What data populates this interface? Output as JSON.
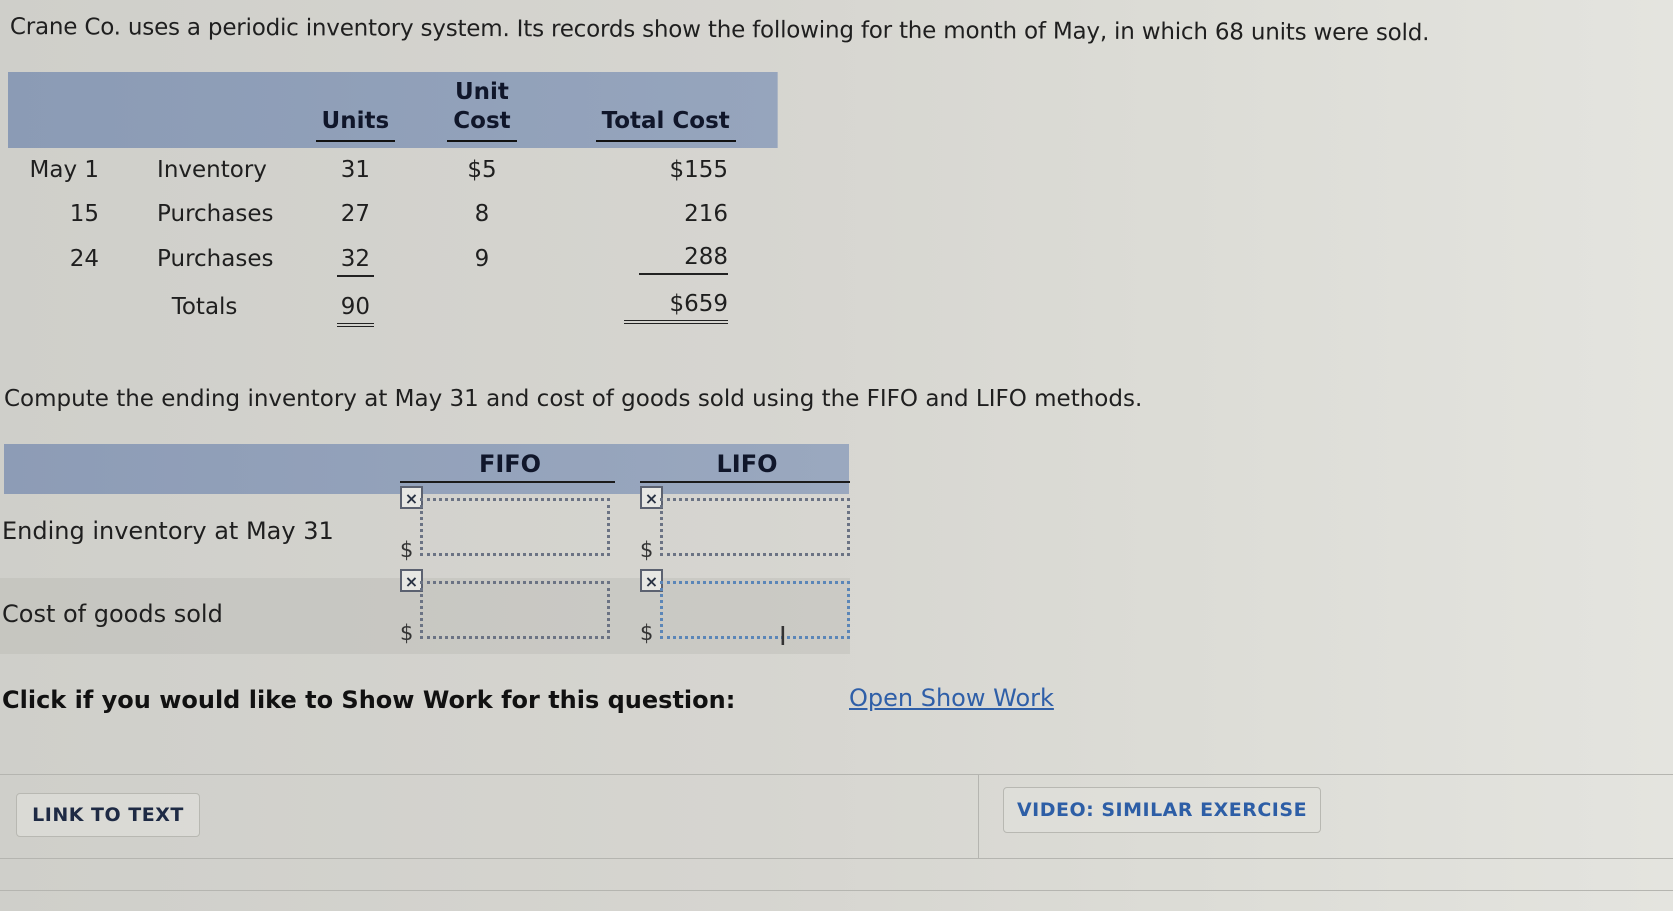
{
  "problem": {
    "intro": "Crane Co. uses a periodic inventory system. Its records show the following for the month of May, in which 68 units were sold.",
    "instruction": "Compute the ending inventory at May 31 and cost of goods sold using the FIFO and LIFO methods."
  },
  "records_table": {
    "headers": {
      "units": "Units",
      "unit_cost_line1": "Unit",
      "unit_cost_line2": "Cost",
      "total_cost": "Total Cost"
    },
    "rows": [
      {
        "date": "May 1",
        "description": "Inventory",
        "units": "31",
        "unit_cost": "$5",
        "total_cost": "$155"
      },
      {
        "date": "15",
        "description": "Purchases",
        "units": "27",
        "unit_cost": "8",
        "total_cost": "216"
      },
      {
        "date": "24",
        "description": "Purchases",
        "units": "32",
        "unit_cost": "9",
        "total_cost": "288"
      }
    ],
    "totals": {
      "label": "Totals",
      "units": "90",
      "total_cost": "$659"
    }
  },
  "answer_grid": {
    "columns": [
      "FIFO",
      "LIFO"
    ],
    "rows": [
      {
        "label": "Ending inventory at May 31",
        "fifo_value": "",
        "lifo_value": ""
      },
      {
        "label": "Cost of goods sold",
        "fifo_value": "",
        "lifo_value": ""
      }
    ],
    "currency_symbol": "$",
    "incorrect_mark": "×"
  },
  "show_work": {
    "prompt": "Click if you would like to Show Work for this question:",
    "link_label": "Open Show Work"
  },
  "footer": {
    "link_to_text_label": "LINK TO TEXT",
    "video_label": "VIDEO: SIMILAR EXERCISE"
  },
  "colors": {
    "header_band": "#8d9cb6",
    "link": "#2f5fa8",
    "video_button_text": "#2d5ea6"
  }
}
